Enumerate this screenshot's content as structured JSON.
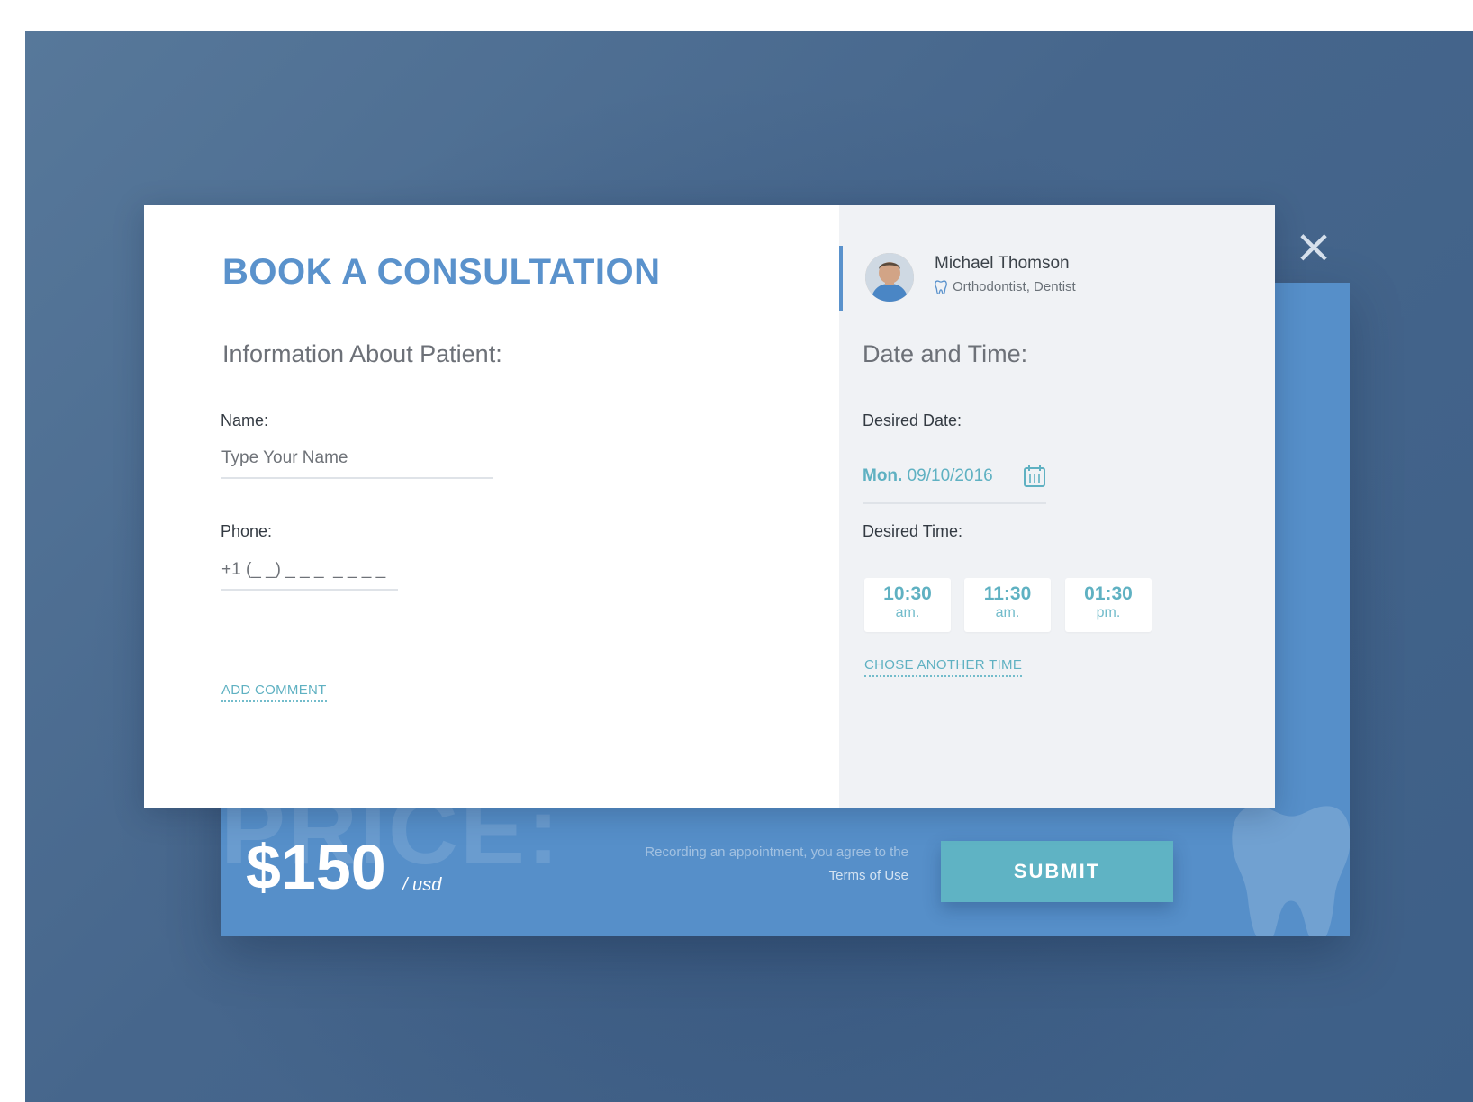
{
  "close_icon": "close-icon",
  "form": {
    "title": "BOOK A CONSULTATION",
    "patient_heading": "Information About Patient:",
    "name_label": "Name:",
    "name_placeholder": "Type Your Name",
    "phone_label": "Phone:",
    "phone_placeholder": "+1 (_ _) _ _ _  _ _ _ _",
    "add_comment": "ADD COMMENT"
  },
  "doctor": {
    "name": "Michael Thomson",
    "specialty": "Orthodontist, Dentist",
    "specialty_icon": "tooth-icon"
  },
  "schedule": {
    "heading": "Date and Time:",
    "date_label": "Desired Date:",
    "date_day": "Mon.",
    "date_value": "09/10/2016",
    "calendar_icon": "calendar-icon",
    "time_label": "Desired Time:",
    "slots": [
      {
        "time": "10:30",
        "period": "am."
      },
      {
        "time": "11:30",
        "period": "am."
      },
      {
        "time": "01:30",
        "period": "pm."
      }
    ],
    "another_time": "CHOSE ANOTHER TIME"
  },
  "price": {
    "ghost_label": "PRICE:",
    "amount": "$150",
    "unit": "/ usd",
    "consent_text": "Recording an appointment, you agree to the",
    "terms_link": "Terms of Use",
    "submit": "SUBMIT"
  },
  "colors": {
    "backdrop": "#4a6b90",
    "accent_blue": "#5a92cc",
    "teal": "#5fb1c2",
    "price_panel": "#568fc9",
    "submit_button": "#5fb3c4"
  }
}
